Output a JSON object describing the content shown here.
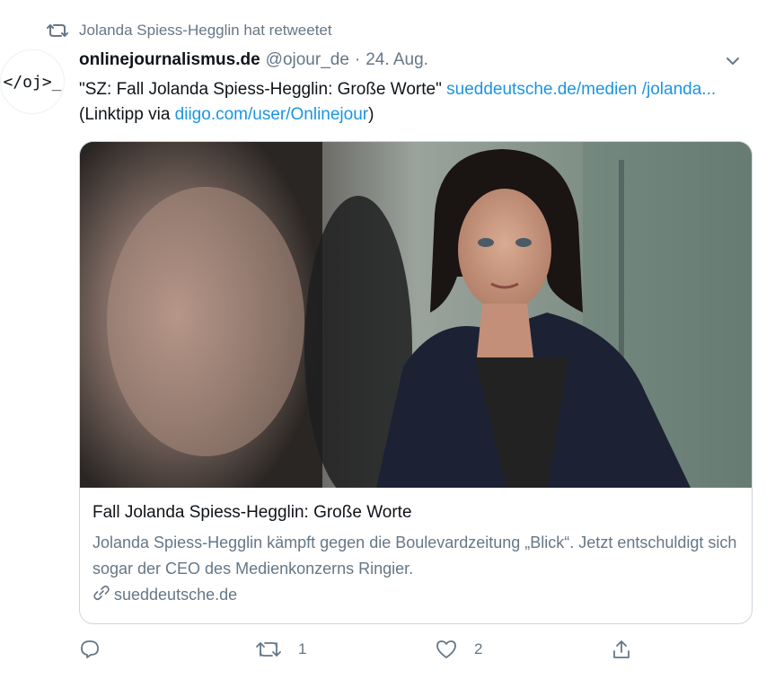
{
  "social_context": {
    "text": "Jolanda Spiess-Hegglin hat retweetet"
  },
  "author": {
    "avatar_text": "</oj>_",
    "display_name": "onlinejournalismus.de",
    "handle": "@ojour_de",
    "separator": "·",
    "date": "24. Aug."
  },
  "tweet": {
    "text_part1": "\"SZ: Fall Jolanda Spiess-Hegglin: Große Worte\" ",
    "link1": "sueddeutsche.de/medien /jolanda...",
    "text_part2": " (Linktipp via ",
    "link2": "diigo.com/user/Onlinejour",
    "text_part3": ")"
  },
  "card": {
    "title": "Fall Jolanda Spiess-Hegglin: Große Worte",
    "description": "Jolanda Spiess-Hegglin kämpft gegen die Boulevardzeitung „Blick“. Jetzt entschuldigt sich sogar der CEO des Medienkonzerns Ringier.",
    "domain": "sueddeutsche.de",
    "image_alt": "photo"
  },
  "actions": {
    "reply_count": "",
    "retweet_count": "1",
    "like_count": "2"
  },
  "colors": {
    "link": "#1b95e0",
    "secondary_text": "#657786",
    "border": "#ccd6dd"
  },
  "icons": [
    "retweet-icon",
    "chevron-down-icon",
    "link-icon",
    "reply-icon",
    "like-icon",
    "share-icon"
  ]
}
